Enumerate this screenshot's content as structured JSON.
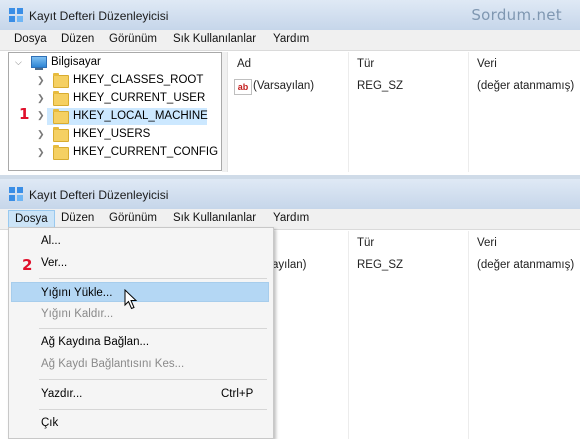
{
  "window_top": {
    "title": "Kayıt Defteri Düzenleyicisi",
    "watermark": "Sordum.net",
    "menu": [
      "Dosya",
      "Düzen",
      "Görünüm",
      "Sık Kullanılanlar",
      "Yardım"
    ],
    "tree": {
      "root": "Bilgisayar",
      "keys": [
        "HKEY_CLASSES_ROOT",
        "HKEY_CURRENT_USER",
        "HKEY_LOCAL_MACHINE",
        "HKEY_USERS",
        "HKEY_CURRENT_CONFIG"
      ],
      "selected_index": 2
    },
    "step_marker": "1",
    "columns": [
      "Ad",
      "Tür",
      "Veri"
    ],
    "row": {
      "icon": "ab",
      "name": "(Varsayılan)",
      "type": "REG_SZ",
      "data": "(değer atanmamış)"
    }
  },
  "window_bottom": {
    "title": "Kayıt Defteri Düzenleyicisi",
    "menu": [
      "Dosya",
      "Düzen",
      "Görünüm",
      "Sık Kullanılanlar",
      "Yardım"
    ],
    "columns": [
      "Tür",
      "Veri"
    ],
    "row": {
      "name_partial": "ayılan)",
      "type": "REG_SZ",
      "data": "(değer atanmamış)"
    },
    "step_marker": "2",
    "file_menu": {
      "items": [
        {
          "label": "Al...",
          "enabled": true
        },
        {
          "label": "Ver...",
          "enabled": true
        },
        {
          "label": "Yığını Yükle...",
          "enabled": true,
          "highlighted": true
        },
        {
          "label": "Yığını Kaldır...",
          "enabled": false
        },
        {
          "label": "Ağ Kaydına Bağlan...",
          "enabled": true
        },
        {
          "label": "Ağ Kaydı Bağlantısını Kes...",
          "enabled": false
        },
        {
          "label": "Yazdır...",
          "enabled": true,
          "shortcut": "Ctrl+P"
        },
        {
          "label": "Çık",
          "enabled": true
        }
      ]
    }
  },
  "colors": {
    "accent": "#e0102b",
    "highlight": "#b4d7f4",
    "selection": "#cce8ff"
  }
}
